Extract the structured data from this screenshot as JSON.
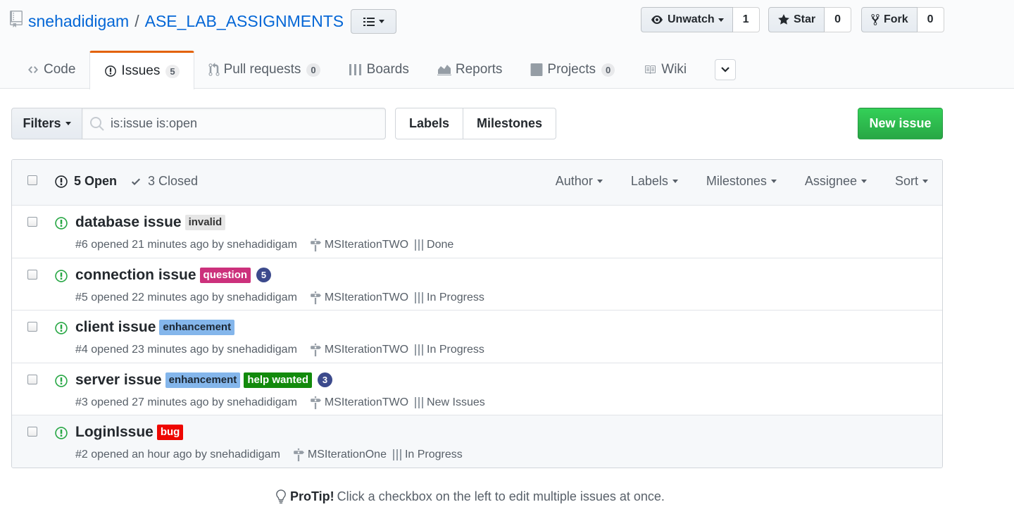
{
  "repo": {
    "owner": "snehadidigam",
    "separator": "/",
    "name": "ASE_LAB_ASSIGNMENTS"
  },
  "social": {
    "watch_label": "Unwatch",
    "watch_count": "1",
    "star_label": "Star",
    "star_count": "0",
    "fork_label": "Fork",
    "fork_count": "0"
  },
  "tabs": [
    {
      "label": "Code",
      "icon": "code-icon"
    },
    {
      "label": "Issues",
      "counter": "5",
      "icon": "issue-opened-icon",
      "selected": true
    },
    {
      "label": "Pull requests",
      "counter": "0",
      "icon": "git-pull-request-icon"
    },
    {
      "label": "Boards",
      "icon": "boards-icon"
    },
    {
      "label": "Reports",
      "icon": "graph-icon"
    },
    {
      "label": "Projects",
      "counter": "0",
      "icon": "project-icon"
    },
    {
      "label": "Wiki",
      "icon": "book-icon"
    }
  ],
  "toolbar": {
    "filters_label": "Filters",
    "search_value": "is:issue is:open",
    "labels_label": "Labels",
    "milestones_label": "Milestones",
    "new_issue_label": "New issue"
  },
  "issues_header": {
    "open_label": "5 Open",
    "closed_label": "3 Closed",
    "filters": [
      "Author",
      "Labels",
      "Milestones",
      "Assignee",
      "Sort"
    ]
  },
  "issues": [
    {
      "title": "database issue",
      "labels": [
        {
          "name": "invalid",
          "bg": "#e6e6e6",
          "fg": "#333333"
        }
      ],
      "comments": "",
      "meta": "#6 opened 21 minutes ago by snehadidigam",
      "milestone": "MSIterationTWO",
      "project_column": "Done"
    },
    {
      "title": "connection issue",
      "labels": [
        {
          "name": "question",
          "bg": "#cc317c",
          "fg": "#ffffff"
        }
      ],
      "comments": "5",
      "meta": "#5 opened 22 minutes ago by snehadidigam",
      "milestone": "MSIterationTWO",
      "project_column": "In Progress"
    },
    {
      "title": "client issue",
      "labels": [
        {
          "name": "enhancement",
          "bg": "#84b6eb",
          "fg": "#1c2733"
        }
      ],
      "comments": "",
      "meta": "#4 opened 23 minutes ago by snehadidigam",
      "milestone": "MSIterationTWO",
      "project_column": "In Progress"
    },
    {
      "title": "server issue",
      "labels": [
        {
          "name": "enhancement",
          "bg": "#84b6eb",
          "fg": "#1c2733"
        },
        {
          "name": "help wanted",
          "bg": "#128a0c",
          "fg": "#ffffff"
        }
      ],
      "comments": "3",
      "meta": "#3 opened 27 minutes ago by snehadidigam",
      "milestone": "MSIterationTWO",
      "project_column": "New Issues"
    },
    {
      "title": "LoginIssue",
      "labels": [
        {
          "name": "bug",
          "bg": "#ee0701",
          "fg": "#ffffff"
        }
      ],
      "comments": "",
      "meta": "#2 opened an hour ago by snehadidigam",
      "milestone": "MSIterationOne",
      "project_column": "In Progress"
    }
  ],
  "protip": {
    "lead": "ProTip!",
    "text": "Click a checkbox on the left to edit multiple issues at once."
  },
  "colors": {
    "link": "#0366d6",
    "open_state": "#28a745",
    "tab_accent": "#e36209",
    "new_issue_green": "#28a745",
    "comment_badge": "#3c4a8c"
  }
}
